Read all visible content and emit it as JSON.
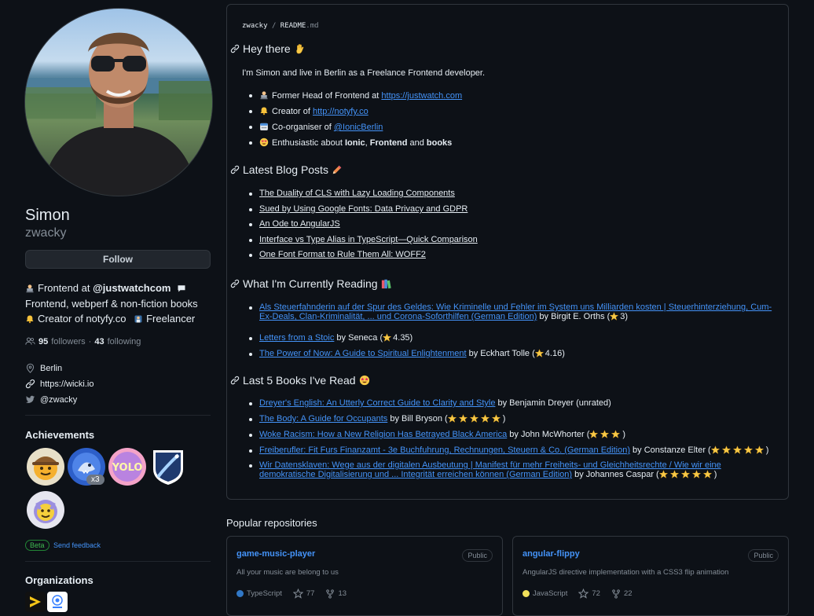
{
  "profile": {
    "full_name": "Simon",
    "username": "zwacky",
    "follow_label": "Follow",
    "bio": {
      "line1_prefix": "Frontend at ",
      "line1_org": "@justwatchcom",
      "line2": "Frontend, webperf & non-fiction books",
      "line3_a": "Creator of notyfy.co",
      "line3_b": "Freelancer"
    },
    "followers_count": "95",
    "followers_label": "followers",
    "separator": "·",
    "following_count": "43",
    "following_label": "following",
    "location": "Berlin",
    "website": "https://wicki.io",
    "twitter": "@zwacky"
  },
  "achievements": {
    "title": "Achievements",
    "multiplier": "x3",
    "beta_label": "Beta",
    "feedback_label": "Send feedback"
  },
  "organizations": {
    "title": "Organizations"
  },
  "readme": {
    "breadcrumb_user": "zwacky",
    "breadcrumb_sep": "/",
    "breadcrumb_file": "README",
    "breadcrumb_ext": ".md",
    "hey": {
      "heading": "Hey there",
      "intro": "I'm Simon and live in Berlin as a Freelance Frontend developer.",
      "item1_text": "Former Head of Frontend at ",
      "item1_link": "https://justwatch.com",
      "item2_text": "Creator of ",
      "item2_link": "http://notyfy.co",
      "item3_text": "Co-organiser of ",
      "item3_link": "@IonicBerlin",
      "item4_text": "Enthusiastic about ",
      "item4_b1": "Ionic",
      "item4_sep": ", ",
      "item4_b2": "Frontend",
      "item4_and": " and ",
      "item4_b3": "books"
    },
    "blog": {
      "heading": "Latest Blog Posts",
      "posts": [
        "The Duality of CLS with Lazy Loading Components",
        "Sued by Using Google Fonts: Data Privacy and GDPR",
        "An Ode to AngularJS",
        "Interface vs Type Alias in TypeScript—Quick Comparison",
        "One Font Format to Rule Them All: WOFF2"
      ]
    },
    "reading": {
      "heading": "What I'm Currently Reading",
      "items": [
        {
          "title_line1": "Als Steuerfahnderin auf der Spur des Geldes: Wie Kriminelle und Fehler im System uns Milliarden kosten | Steuerhinterziehung, Cum-",
          "title_line2": "Ex-Deals, Clan-Kriminalität, ... und Corona-Soforthilfen (German Edition)",
          "author": " by Birgit E. Orths (",
          "rating": "3)"
        },
        {
          "title": "Letters from a Stoic",
          "author": " by Seneca (",
          "rating": "4.35)"
        },
        {
          "title": "The Power of Now: A Guide to Spiritual Enlightenment",
          "author": " by Eckhart Tolle (",
          "rating": "4.16)"
        }
      ]
    },
    "last5": {
      "heading": "Last 5 Books I've Read",
      "items": [
        {
          "title": "Dreyer's English: An Utterly Correct Guide to Clarity and Style",
          "author": " by Benjamin Dreyer (unrated)",
          "stars": 0,
          "close": ""
        },
        {
          "title": "The Body: A Guide for Occupants",
          "author": " by Bill Bryson (",
          "stars": 5,
          "close": ")"
        },
        {
          "title": "Woke Racism: How a New Religion Has Betrayed Black America",
          "author": " by John McWhorter (",
          "stars": 3,
          "close": ")"
        },
        {
          "title": "Freiberufler: Fit Furs Finanzamt - 3e Buchfuhrung, Rechnungen, Steuern & Co. (German Edition)",
          "author": " by Constanze Elter (",
          "stars": 5,
          "close": ")"
        },
        {
          "title_line1": "Wir Datensklaven: Wege aus der digitalen Ausbeutung | Manifest für mehr Freiheits- und Gleichheitsrechte / Wie wir eine",
          "title_line2": "demokratische Digitalisierung und ... Integrität erreichen können (German Edition)",
          "author": " by Johannes Caspar (",
          "stars": 5,
          "close": ")"
        }
      ]
    }
  },
  "popular": {
    "title": "Popular repositories",
    "repos": [
      {
        "name": "game-music-player",
        "visibility": "Public",
        "description": "All your music are belong to us",
        "language": "TypeScript",
        "language_color": "#3178c6",
        "stars": "77",
        "forks": "13"
      },
      {
        "name": "angular-flippy",
        "visibility": "Public",
        "description": "AngularJS directive implementation with a CSS3 flip animation",
        "language": "JavaScript",
        "language_color": "#f1e05a",
        "stars": "72",
        "forks": "22"
      }
    ]
  },
  "colors": {
    "link": "#4493f8",
    "background": "#0d1117",
    "border": "#30363d",
    "muted": "#848d97"
  }
}
